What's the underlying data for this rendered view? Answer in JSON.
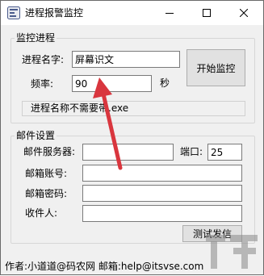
{
  "window": {
    "title": "进程报警监控"
  },
  "monitor_group": {
    "title": "监控进程",
    "process_name_label": "进程名字:",
    "process_name_value": "屏幕识文",
    "interval_label": "频率:",
    "interval_value": "90",
    "interval_unit": "秒",
    "start_button": "开始监控",
    "hint": "进程名称不需要带.exe"
  },
  "mail_group": {
    "title": "邮件设置",
    "server_label": "邮件服务器:",
    "server_value": "",
    "port_label": "端口:",
    "port_value": "25",
    "account_label": "邮箱账号:",
    "account_value": "",
    "password_label": "邮箱密码:",
    "password_value": "",
    "recipient_label": "收件人:",
    "recipient_value": "",
    "test_button": "测试发信"
  },
  "footer": {
    "text": "作者:小道道@码农网  邮箱:help@itsvse.com"
  },
  "colors": {
    "annotation_arrow": "#d9363e",
    "window_bg": "#f0f0f0"
  },
  "icons": {
    "app": "app-icon",
    "minimize": "minimize-icon",
    "maximize": "maximize-icon",
    "close": "close-icon"
  }
}
